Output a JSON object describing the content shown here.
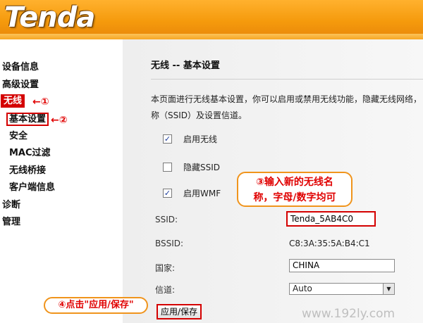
{
  "brand": {
    "logo_text": "Tenda",
    "header_color": "#f59a0c"
  },
  "sidebar": {
    "items": [
      {
        "label": "设备信息",
        "level": 1
      },
      {
        "label": "高级设置",
        "level": 1
      },
      {
        "label": "无线",
        "level": 1,
        "annotation": "←①"
      },
      {
        "label": "基本设置",
        "level": 2,
        "annotation": "←②"
      },
      {
        "label": "安全",
        "level": 2
      },
      {
        "label": "MAC过滤",
        "level": 2
      },
      {
        "label": "无线桥接",
        "level": 2
      },
      {
        "label": "客户端信息",
        "level": 2
      },
      {
        "label": "诊断",
        "level": 1
      },
      {
        "label": "管理",
        "level": 1
      }
    ]
  },
  "main": {
    "title": "无线 -- 基本设置",
    "description": "本页面进行无线基本设置，你可以启用或禁用无线功能，隐藏无线网络，称（SSID）及设置信道。",
    "checkboxes": [
      {
        "label": "启用无线",
        "checked": true,
        "mark": "✓"
      },
      {
        "label": "隐藏SSID",
        "checked": false,
        "mark": ""
      },
      {
        "label": "启用WMF",
        "checked": true,
        "mark": "✓"
      }
    ],
    "fields": {
      "ssid_label": "SSID:",
      "ssid_value": "Tenda_5AB4C0",
      "bssid_label": "BSSID:",
      "bssid_value": "C8:3A:35:5A:B4:C1",
      "country_label": "国家:",
      "country_value": "CHINA",
      "channel_label": "信道:",
      "channel_value": "Auto"
    },
    "save_button": "应用/保存"
  },
  "callouts": {
    "step3_line1": "③输入新的无线名",
    "step3_line2": "称，字母/数字均可",
    "step4": "④点击\"应用/保存\""
  },
  "watermark": "www.192ly.com",
  "colors": {
    "annotation_red": "#d40000",
    "callout_border": "#f0941c"
  }
}
